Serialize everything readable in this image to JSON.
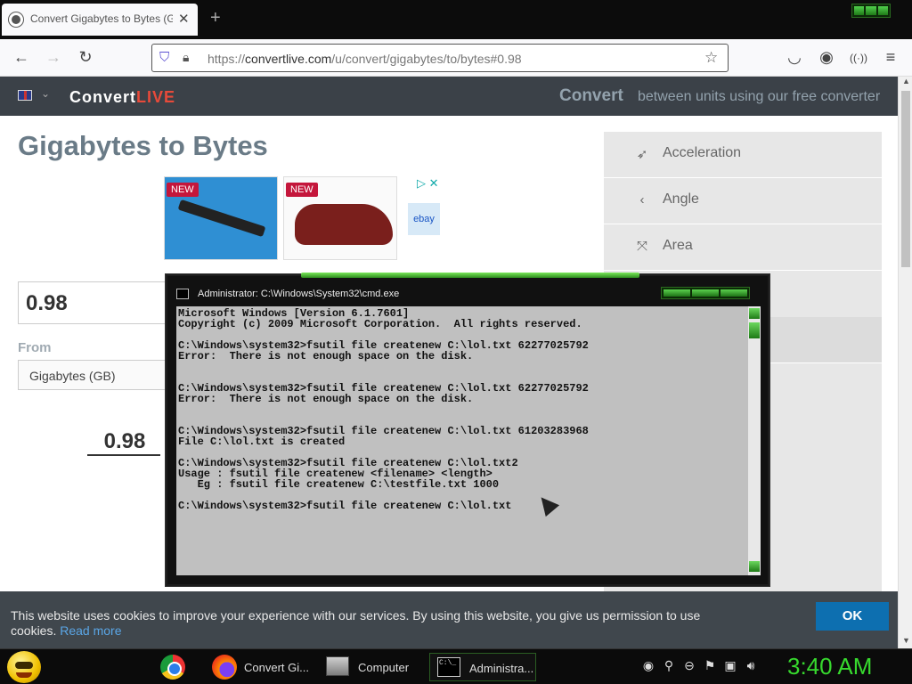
{
  "browser": {
    "tab_title": "Convert Gigabytes to Bytes (GB",
    "url_prefix": "https://",
    "url_domain": "convertlive.com",
    "url_path": "/u/convert/gigabytes/to/bytes#0.98"
  },
  "site": {
    "brand_main": "Convert",
    "brand_accent": "LIVE",
    "header_convert": "Convert",
    "header_tagline": "between units using our free converter",
    "page_title": "Gigabytes to Bytes",
    "ad_new_1": "NEW",
    "ad_new_2": "NEW",
    "ad_ebay": "ebay",
    "input_value": "0.98",
    "from_label": "From",
    "from_value": "Gigabytes (GB)",
    "result_value": "0.98",
    "categories": [
      {
        "label": "Acceleration",
        "icon": "rocket-icon"
      },
      {
        "label": "Angle",
        "icon": "angle-icon"
      },
      {
        "label": "Area",
        "icon": "area-icon"
      }
    ]
  },
  "cookie": {
    "text": "This website uses cookies to improve your experience with our services. By using this website, you give us permission to use cookies.",
    "read_more": "Read more",
    "ok_label": "OK"
  },
  "cmd": {
    "title": "Administrator: C:\\Windows\\System32\\cmd.exe",
    "output": "Microsoft Windows [Version 6.1.7601]\nCopyright (c) 2009 Microsoft Corporation.  All rights reserved.\n\nC:\\Windows\\system32>fsutil file createnew C:\\lol.txt 62277025792\nError:  There is not enough space on the disk.\n\n\nC:\\Windows\\system32>fsutil file createnew C:\\lol.txt 62277025792\nError:  There is not enough space on the disk.\n\n\nC:\\Windows\\system32>fsutil file createnew C:\\lol.txt 61203283968\nFile C:\\lol.txt is created\n\nC:\\Windows\\system32>fsutil file createnew C:\\lol.txt2\nUsage : fsutil file createnew <filename> <length>\n   Eg : fsutil file createnew C:\\testfile.txt 1000\n\nC:\\Windows\\system32>fsutil file createnew C:\\lol.txt"
  },
  "taskbar": {
    "firefox_label": "Convert Gi...",
    "computer_label": "Computer",
    "cmd_label": "Administra...",
    "cmd_icon_text": "C:\\_",
    "clock": "3:40 AM"
  }
}
